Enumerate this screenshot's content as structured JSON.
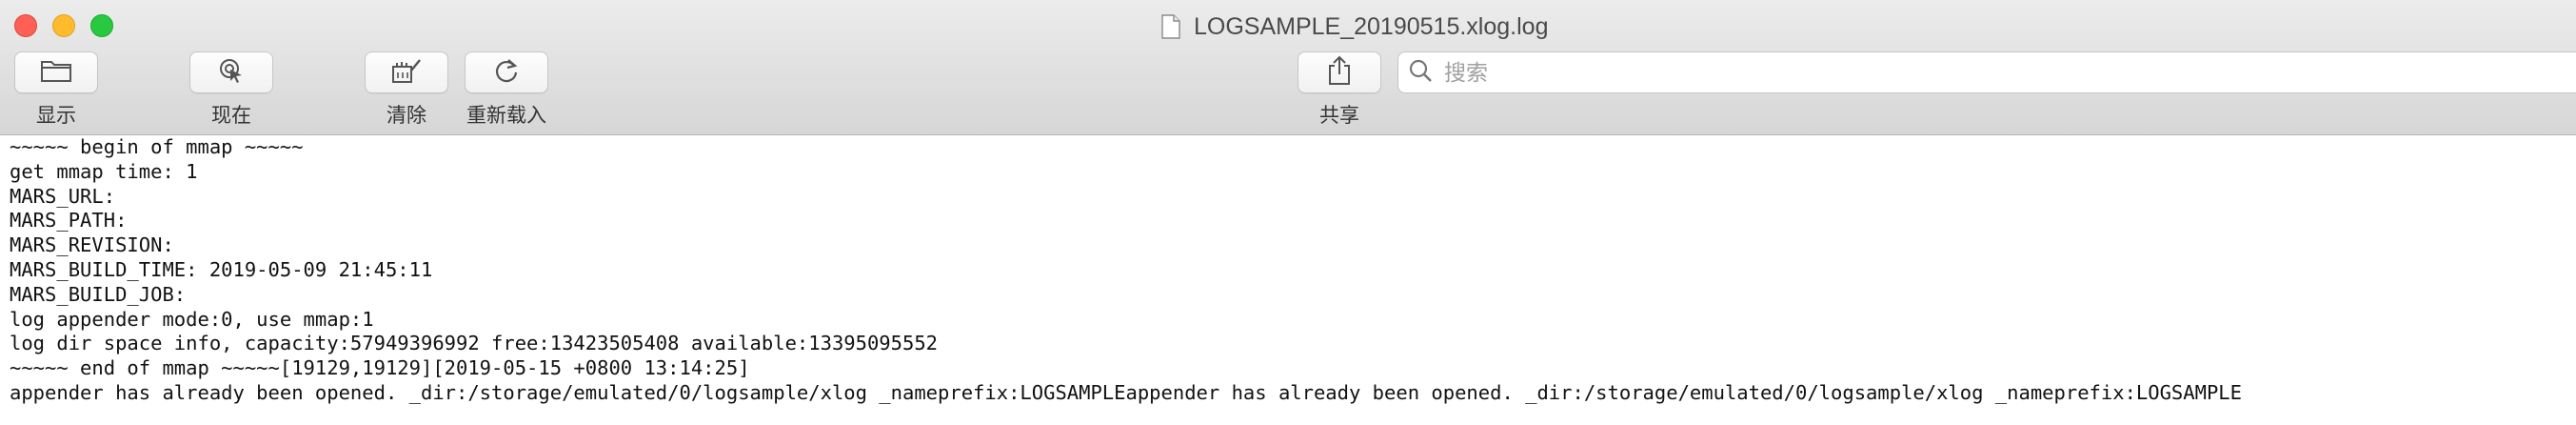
{
  "window": {
    "title": "LOGSAMPLE_20190515.xlog.log"
  },
  "toolbar": {
    "show_label": "显示",
    "now_label": "现在",
    "clear_label": "清除",
    "reload_label": "重新载入",
    "share_label": "共享"
  },
  "search": {
    "placeholder": "搜索",
    "value": ""
  },
  "icons": {
    "show": "folder-icon",
    "now": "target-cursor-icon",
    "clear": "broom-icon",
    "reload": "refresh-icon",
    "share": "share-icon",
    "search": "search-icon",
    "document": "document-icon"
  },
  "colors": {
    "close": "#fe5f57",
    "minimize": "#febb2e",
    "maximize": "#28c840"
  },
  "log": {
    "lines": [
      "~~~~~ begin of mmap ~~~~~",
      "get mmap time: 1",
      "MARS_URL:",
      "MARS_PATH:",
      "MARS_REVISION:",
      "MARS_BUILD_TIME: 2019-05-09 21:45:11",
      "MARS_BUILD_JOB:",
      "log appender mode:0, use mmap:1",
      "log dir space info, capacity:57949396992 free:13423505408 available:13395095552",
      "~~~~~ end of mmap ~~~~~[19129,19129][2019-05-15 +0800 13:14:25]",
      "appender has already been opened. _dir:/storage/emulated/0/logsample/xlog _nameprefix:LOGSAMPLEappender has already been opened. _dir:/storage/emulated/0/logsample/xlog _nameprefix:LOGSAMPLE"
    ]
  }
}
